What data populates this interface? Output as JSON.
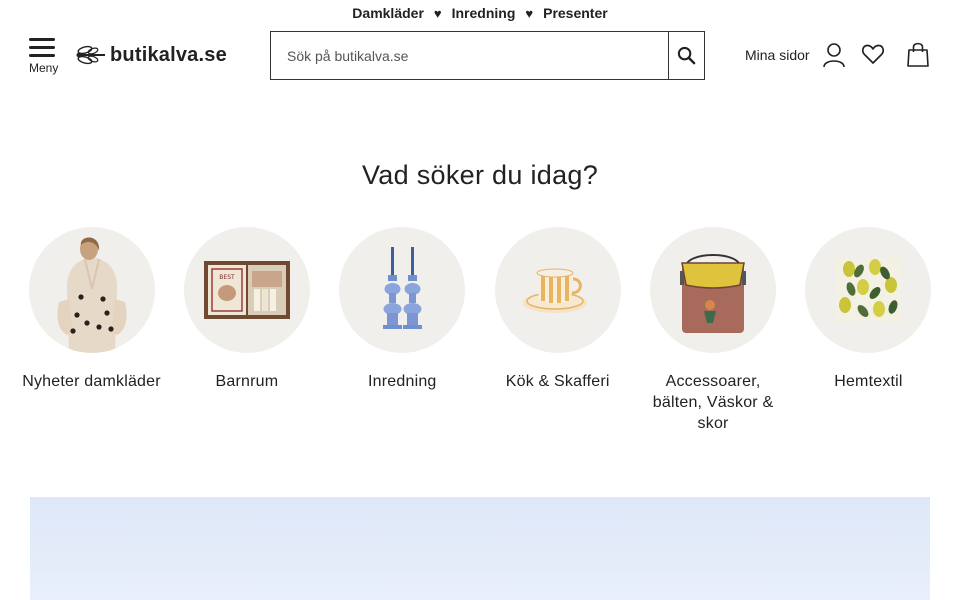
{
  "topbar": {
    "links": [
      "Damkläder",
      "Inredning",
      "Presenter"
    ]
  },
  "header": {
    "menu_label": "Meny",
    "logo_text": "butikalva.se",
    "search_placeholder": "Sök på butikalva.se",
    "account_label": "Mina sidor"
  },
  "main": {
    "heading": "Vad söker du idag?",
    "categories": [
      {
        "label": "Nyheter damkläder"
      },
      {
        "label": "Barnrum"
      },
      {
        "label": "Inredning"
      },
      {
        "label": "Kök & Skafferi"
      },
      {
        "label": "Accessoarer, bälten, Väskor & skor"
      },
      {
        "label": "Hemtextil"
      }
    ]
  },
  "colors": {
    "text": "#222222",
    "circle_bg": "#f1efeb",
    "banner_bg": "#e4ecf9"
  }
}
